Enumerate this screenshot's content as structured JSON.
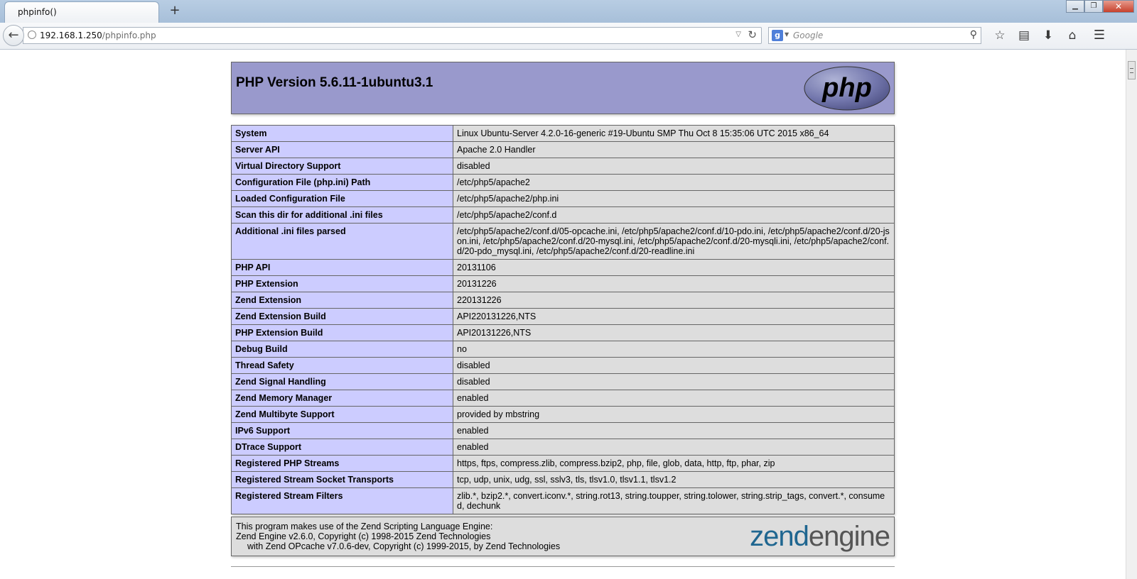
{
  "browser": {
    "tab_title": "phpinfo()",
    "url_host": "192.168.1.250",
    "url_path": "/phpinfo.php",
    "search_placeholder": "Google",
    "icons": [
      "back-arrow-icon",
      "globe-icon",
      "reload-icon",
      "google-icon",
      "search-icon",
      "bookmark-star-icon",
      "reading-list-icon",
      "download-icon",
      "home-icon",
      "menu-icon"
    ]
  },
  "php": {
    "version_title": "PHP Version 5.6.11-1ubuntu3.1",
    "logo_text": "php",
    "rows": [
      {
        "key": "System",
        "value": "Linux Ubuntu-Server 4.2.0-16-generic #19-Ubuntu SMP Thu Oct 8 15:35:06 UTC 2015 x86_64"
      },
      {
        "key": "Server API",
        "value": "Apache 2.0 Handler"
      },
      {
        "key": "Virtual Directory Support",
        "value": "disabled"
      },
      {
        "key": "Configuration File (php.ini) Path",
        "value": "/etc/php5/apache2"
      },
      {
        "key": "Loaded Configuration File",
        "value": "/etc/php5/apache2/php.ini"
      },
      {
        "key": "Scan this dir for additional .ini files",
        "value": "/etc/php5/apache2/conf.d"
      },
      {
        "key": "Additional .ini files parsed",
        "value": "/etc/php5/apache2/conf.d/05-opcache.ini, /etc/php5/apache2/conf.d/10-pdo.ini, /etc/php5/apache2/conf.d/20-json.ini, /etc/php5/apache2/conf.d/20-mysql.ini, /etc/php5/apache2/conf.d/20-mysqli.ini, /etc/php5/apache2/conf.d/20-pdo_mysql.ini, /etc/php5/apache2/conf.d/20-readline.ini"
      },
      {
        "key": "PHP API",
        "value": "20131106"
      },
      {
        "key": "PHP Extension",
        "value": "20131226"
      },
      {
        "key": "Zend Extension",
        "value": "220131226"
      },
      {
        "key": "Zend Extension Build",
        "value": "API220131226,NTS"
      },
      {
        "key": "PHP Extension Build",
        "value": "API20131226,NTS"
      },
      {
        "key": "Debug Build",
        "value": "no"
      },
      {
        "key": "Thread Safety",
        "value": "disabled"
      },
      {
        "key": "Zend Signal Handling",
        "value": "disabled"
      },
      {
        "key": "Zend Memory Manager",
        "value": "enabled"
      },
      {
        "key": "Zend Multibyte Support",
        "value": "provided by mbstring"
      },
      {
        "key": "IPv6 Support",
        "value": "enabled"
      },
      {
        "key": "DTrace Support",
        "value": "enabled"
      },
      {
        "key": "Registered PHP Streams",
        "value": "https, ftps, compress.zlib, compress.bzip2, php, file, glob, data, http, ftp, phar, zip"
      },
      {
        "key": "Registered Stream Socket Transports",
        "value": "tcp, udp, unix, udg, ssl, sslv3, tls, tlsv1.0, tlsv1.1, tlsv1.2"
      },
      {
        "key": "Registered Stream Filters",
        "value": "zlib.*, bzip2.*, convert.iconv.*, string.rot13, string.toupper, string.tolower, string.strip_tags, convert.*, consumed, dechunk"
      }
    ],
    "zend": {
      "line1": "This program makes use of the Zend Scripting Language Engine:",
      "line2": "Zend Engine v2.6.0, Copyright (c) 1998-2015 Zend Technologies",
      "line3": "with Zend OPcache v7.0.6-dev, Copyright (c) 1999-2015, by Zend Technologies",
      "logo_word1": "zend",
      "logo_word2": "engine"
    }
  }
}
